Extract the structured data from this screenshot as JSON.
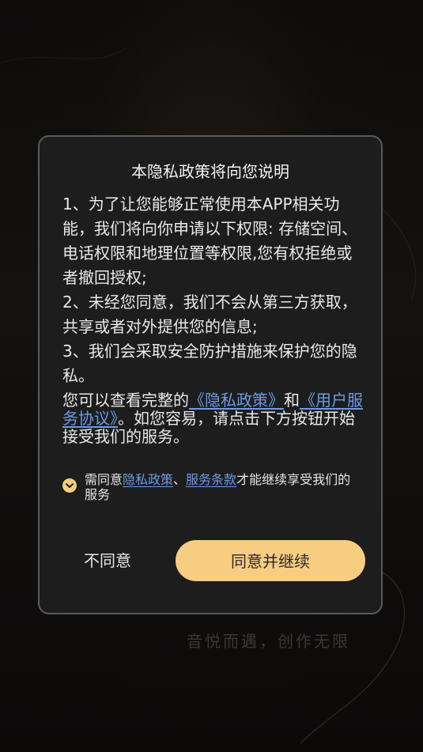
{
  "background": {
    "slogan": "音悦而遇，创作无限"
  },
  "dialog": {
    "title": "本隐私政策将向您说明",
    "paragraphs": {
      "p1": "1、为了让您能够正常使用本APP相关功能，我们将向你申请以下权限: 存储空间、电话权限和地理位置等权限,您有权拒绝或者撤回授权;",
      "p2": "2、未经您同意，我们不会从第三方获取，共享或者对外提供您的信息;",
      "p3": "3、我们会采取安全防护措施来保护您的隐私。"
    },
    "tail": {
      "prefix": "您可以查看完整的",
      "privacy_link": "《隐私政策》",
      "and": "和",
      "service_link": "《用户服务协议》",
      "suffix": "。如您容易，请点击下方按钮开始接受我们的服务。"
    },
    "consent": {
      "prefix": "需同意",
      "privacy_link": "隐私政策",
      "sep": "、",
      "terms_link": "服务条款",
      "suffix": "才能继续享受我们的服务",
      "checked": true
    },
    "buttons": {
      "disagree": "不同意",
      "agree": "同意并继续"
    }
  },
  "colors": {
    "accent": "#f7cd82",
    "link": "#6c9be6",
    "dialog_bg": "#1d1d1d",
    "dialog_border": "#5a5a5a"
  },
  "icons": {
    "consent_check": "check-circle-icon"
  }
}
